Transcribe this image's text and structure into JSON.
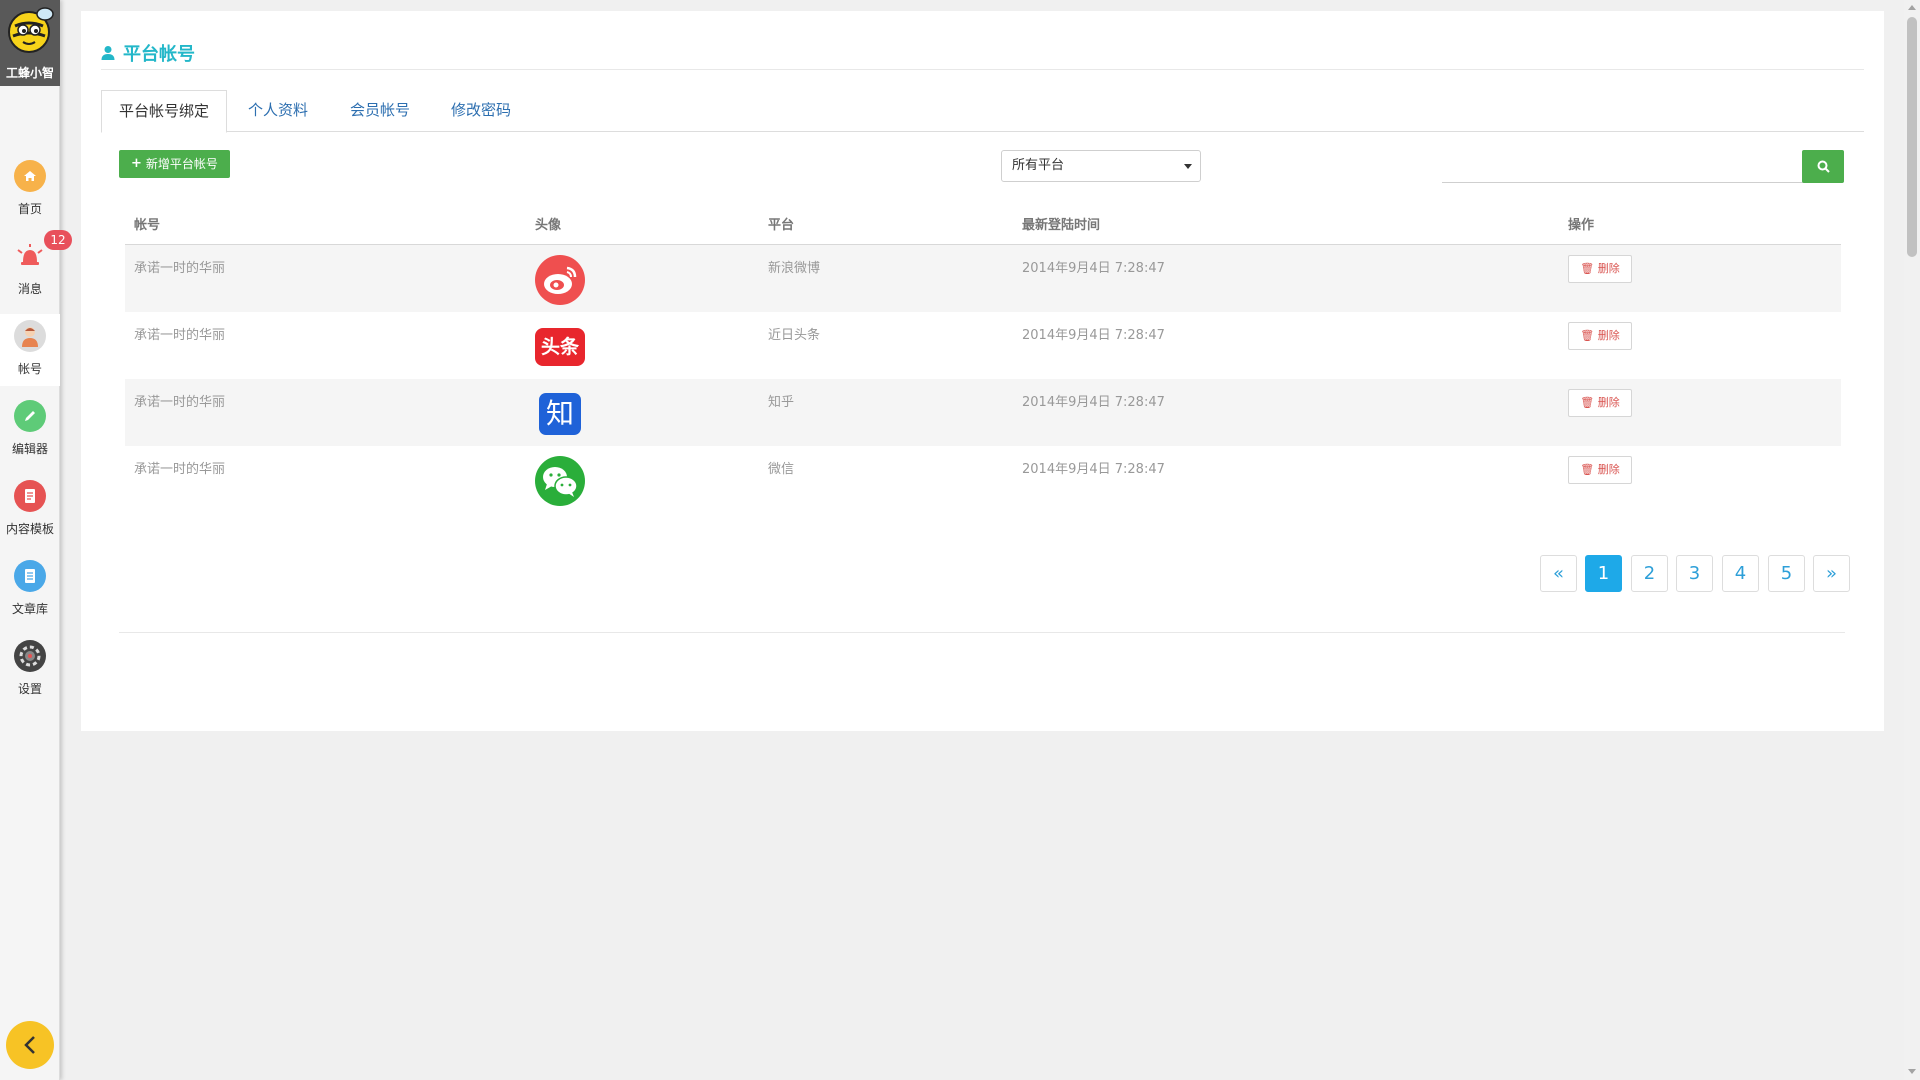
{
  "brand": {
    "name": "工蜂小智",
    "logo_icon": "bee-mascot-icon"
  },
  "sidebar": {
    "items": [
      {
        "label": "首页",
        "icon": "home-icon",
        "color": "#f7b24a"
      },
      {
        "label": "消息",
        "icon": "alarm-bell-icon",
        "color": "#ef5b5b",
        "badge": "12"
      },
      {
        "label": "帐号",
        "icon": "user-avatar-icon",
        "color": "#e9c9a6",
        "active": true
      },
      {
        "label": "编辑器",
        "icon": "pencil-icon",
        "color": "#5ecb78"
      },
      {
        "label": "内容模板",
        "icon": "template-icon",
        "color": "#e65353"
      },
      {
        "label": "文章库",
        "icon": "document-icon",
        "color": "#4aa8e8"
      },
      {
        "label": "设置",
        "icon": "gear-icon",
        "color": "#444444"
      }
    ]
  },
  "page": {
    "title": "平台帐号",
    "title_icon": "user-icon",
    "accent": "#23b7c9"
  },
  "tabs": [
    {
      "label": "平台帐号绑定",
      "active": true
    },
    {
      "label": "个人资料"
    },
    {
      "label": "会员帐号"
    },
    {
      "label": "修改密码"
    }
  ],
  "toolbar": {
    "add_label": "新增平台帐号",
    "platform_select": "所有平台",
    "search_value": "",
    "search_placeholder": ""
  },
  "table": {
    "headers": [
      "帐号",
      "头像",
      "平台",
      "最新登陆时间",
      "操作"
    ],
    "rows": [
      {
        "account": "承诺一时的华丽",
        "avatar": "weibo-icon",
        "platform": "新浪微博",
        "last_login": "2014年9月4日 7:28:47",
        "action": "删除"
      },
      {
        "account": "承诺一时的华丽",
        "avatar": "toutiao-icon",
        "platform": "近日头条",
        "last_login": "2014年9月4日 7:28:47",
        "action": "删除"
      },
      {
        "account": "承诺一时的华丽",
        "avatar": "zhihu-icon",
        "platform": "知乎",
        "last_login": "2014年9月4日 7:28:47",
        "action": "删除"
      },
      {
        "account": "承诺一时的华丽",
        "avatar": "wechat-icon",
        "platform": "微信",
        "last_login": "2014年9月4日 7:28:47",
        "action": "删除"
      }
    ]
  },
  "pagination": {
    "prev": "«",
    "pages": [
      "1",
      "2",
      "3",
      "4",
      "5"
    ],
    "current": "1",
    "next": "»"
  },
  "toutiao_logo_text": "头条",
  "zhihu_logo_text": "知"
}
